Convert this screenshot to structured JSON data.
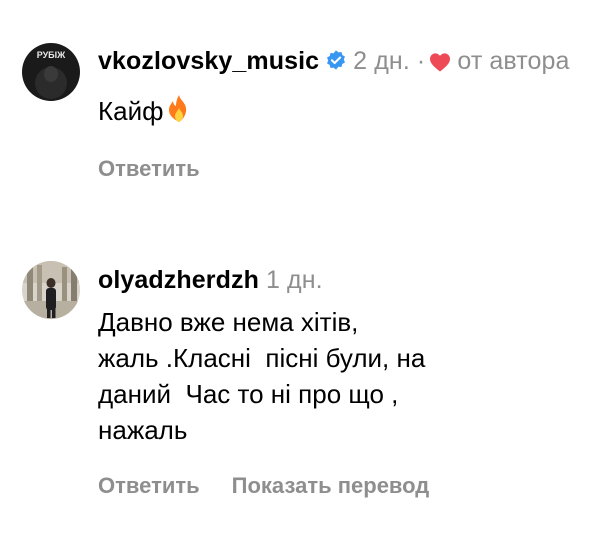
{
  "comments": [
    {
      "username": "vkozlovsky_music",
      "verified": true,
      "time": "2 дн.",
      "separator": "·",
      "author_like": "от автора",
      "avatar_text": "РУБІЖ",
      "text": "Кайф",
      "emoji": "fire",
      "actions": {
        "reply": "Ответить"
      }
    },
    {
      "username": "olyadzherdzh",
      "verified": false,
      "time": "1 дн.",
      "text_lines": [
        "Давно вже нема хітів,",
        "жаль .Класні  пісні були, на",
        "даний  Час то ні про що ,",
        "нажаль"
      ],
      "actions": {
        "reply": "Ответить",
        "translate": "Показать перевод"
      }
    }
  ],
  "colors": {
    "meta": "#8e8e8e",
    "verified": "#3897f0",
    "heart": "#ed4956",
    "fire": "#ff7a1a"
  }
}
